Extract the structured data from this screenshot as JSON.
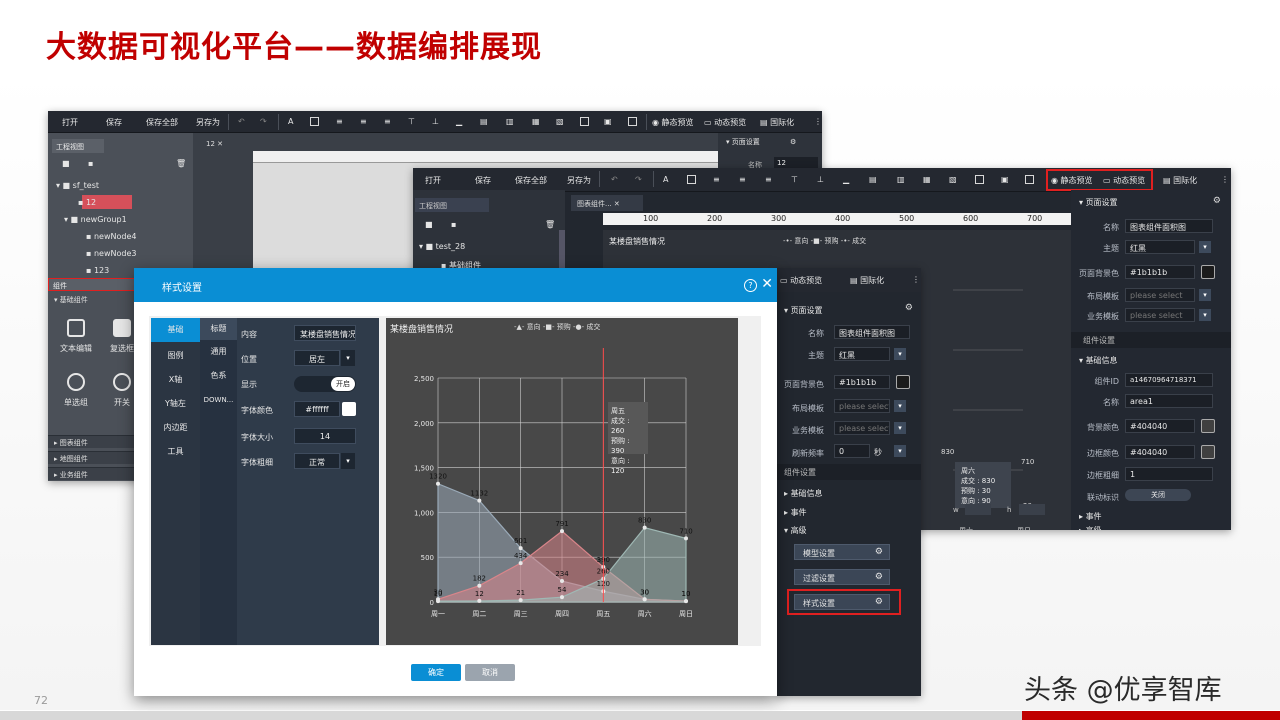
{
  "slide": {
    "title": "大数据可视化平台——数据编排展现",
    "page_number": "72",
    "watermark": "头条 @优享智库",
    "accent_color": "#c00000",
    "highlight_color": "#e02020"
  },
  "toolbar": {
    "open": "打开",
    "save": "保存",
    "save_all": "保存全部",
    "save_as": "另存为",
    "static_preview": "静态预览",
    "dynamic_preview": "动态预览",
    "i18n": "国际化"
  },
  "back_editor": {
    "project_tab": "工程视图",
    "canvas_tab": "12",
    "tree": [
      "sf_test",
      "12",
      "newGroup1",
      "newNode4",
      "newNode3",
      "123"
    ],
    "components_label": "组件",
    "basic_components": "基础组件",
    "component_items": [
      "文本编辑",
      "复选框",
      "单选组",
      "开关"
    ],
    "section_chart": "图表组件",
    "section_map": "地图组件",
    "section_business": "业务组件",
    "page_settings": "页面设置",
    "name_label": "名称",
    "name_value": "12"
  },
  "front_editor": {
    "project_tab": "工程视图",
    "canvas_tab": "图表组件...",
    "tree_root": "test_28",
    "tree_child": "基础组件",
    "chart_title": "某楼盘销售情况",
    "legend": [
      "意向",
      "预购",
      "成交"
    ],
    "ruler_marks": [
      "100",
      "200",
      "300",
      "400",
      "500",
      "600",
      "700"
    ],
    "props": {
      "page_settings": "页面设置",
      "name_label": "名称",
      "name_value": "图表组件面积图",
      "theme_label": "主题",
      "theme_value": "红黑",
      "bg_label": "页面背景色",
      "bg_value": "#1b1b1b",
      "layout_label": "布局模板",
      "layout_value": "please select",
      "biz_label": "业务模板",
      "biz_value": "please select",
      "component_settings": "组件设置",
      "basic_info": "基础信息",
      "id_label": "组件ID",
      "id_value": "a14670964718371",
      "cname_label": "名称",
      "cname_value": "area1",
      "bgcolor_label": "背景颜色",
      "bgcolor_value": "#404040",
      "border_label": "边框颜色",
      "border_value": "#404040",
      "border_width_label": "边框粗细",
      "border_width_value": "1",
      "animation_label": "联动标识",
      "animation_value": "关闭",
      "events": "事件",
      "advanced": "高级"
    },
    "tooltip": {
      "day": "周六",
      "deal": "成交 : 830",
      "pre": "预购 : 30",
      "intent": "意向 : 90"
    },
    "labels_right": [
      "830",
      "710",
      "20"
    ],
    "axis_right": [
      "周六",
      "周日"
    ],
    "status": {
      "w": "w",
      "h": "h"
    }
  },
  "middle_panel": {
    "toolbar_dynamic": "动态预览",
    "toolbar_i18n": "国际化",
    "page_settings": "页面设置",
    "name_label": "名称",
    "name_value": "图表组件面积图",
    "theme_label": "主题",
    "theme_value": "红黑",
    "bg_label": "页面背景色",
    "bg_value": "#1b1b1b",
    "layout_label": "布局模板",
    "layout_value": "please select",
    "biz_label": "业务模板",
    "biz_value": "please select",
    "refresh_label": "刷新频率",
    "refresh_value": "0",
    "refresh_unit": "秒",
    "component_settings": "组件设置",
    "basic_info": "基础信息",
    "events": "事件",
    "advanced": "高级",
    "model_btn": "模型设置",
    "filter_btn": "过滤设置",
    "style_btn": "样式设置"
  },
  "dialog": {
    "title": "样式设置",
    "nav": [
      "基础",
      "图例",
      "X轴",
      "Y轴左",
      "内边距",
      "工具"
    ],
    "subnav": [
      "标题",
      "通用",
      "色系",
      "DOWN..."
    ],
    "content_label": "内容",
    "content_value": "某楼盘销售情况",
    "position_label": "位置",
    "position_value": "居左",
    "show_label": "显示",
    "show_value": "开启",
    "font_color_label": "字体颜色",
    "font_color_value": "#ffffff",
    "font_size_label": "字体大小",
    "font_size_value": "14",
    "font_weight_label": "字体粗细",
    "font_weight_value": "正常",
    "ok": "确定",
    "cancel": "取消",
    "tooltip": {
      "day": "周五",
      "deal": "成交 : 260",
      "pre": "预购 : 390",
      "intent": "意向 : 120"
    }
  },
  "chart_data": {
    "type": "area",
    "title": "某楼盘销售情况",
    "categories": [
      "周一",
      "周二",
      "周三",
      "周四",
      "周五",
      "周六",
      "周日"
    ],
    "ylim": [
      0,
      2500
    ],
    "yticks": [
      "0",
      "500",
      "1,000",
      "1,500",
      "2,000",
      "2,500"
    ],
    "grid": true,
    "legend_position": "top",
    "series": [
      {
        "name": "意向",
        "values": [
          1320,
          1132,
          601,
          234,
          120,
          30,
          10
        ],
        "color": "#9aaab8"
      },
      {
        "name": "预购",
        "values": [
          30,
          182,
          434,
          791,
          390,
          30,
          10
        ],
        "color": "#d9858a"
      },
      {
        "name": "成交",
        "values": [
          10,
          12,
          21,
          54,
          260,
          830,
          710
        ],
        "color": "#9fb8b4"
      }
    ]
  }
}
